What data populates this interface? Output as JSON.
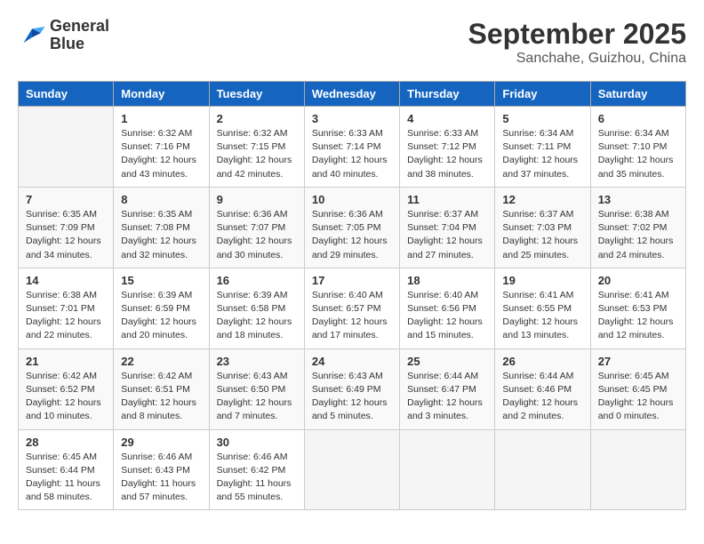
{
  "logo": {
    "line1": "General",
    "line2": "Blue"
  },
  "title": "September 2025",
  "location": "Sanchahe, Guizhou, China",
  "days_of_week": [
    "Sunday",
    "Monday",
    "Tuesday",
    "Wednesday",
    "Thursday",
    "Friday",
    "Saturday"
  ],
  "weeks": [
    [
      {
        "day": "",
        "info": ""
      },
      {
        "day": "1",
        "info": "Sunrise: 6:32 AM\nSunset: 7:16 PM\nDaylight: 12 hours\nand 43 minutes."
      },
      {
        "day": "2",
        "info": "Sunrise: 6:32 AM\nSunset: 7:15 PM\nDaylight: 12 hours\nand 42 minutes."
      },
      {
        "day": "3",
        "info": "Sunrise: 6:33 AM\nSunset: 7:14 PM\nDaylight: 12 hours\nand 40 minutes."
      },
      {
        "day": "4",
        "info": "Sunrise: 6:33 AM\nSunset: 7:12 PM\nDaylight: 12 hours\nand 38 minutes."
      },
      {
        "day": "5",
        "info": "Sunrise: 6:34 AM\nSunset: 7:11 PM\nDaylight: 12 hours\nand 37 minutes."
      },
      {
        "day": "6",
        "info": "Sunrise: 6:34 AM\nSunset: 7:10 PM\nDaylight: 12 hours\nand 35 minutes."
      }
    ],
    [
      {
        "day": "7",
        "info": "Sunrise: 6:35 AM\nSunset: 7:09 PM\nDaylight: 12 hours\nand 34 minutes."
      },
      {
        "day": "8",
        "info": "Sunrise: 6:35 AM\nSunset: 7:08 PM\nDaylight: 12 hours\nand 32 minutes."
      },
      {
        "day": "9",
        "info": "Sunrise: 6:36 AM\nSunset: 7:07 PM\nDaylight: 12 hours\nand 30 minutes."
      },
      {
        "day": "10",
        "info": "Sunrise: 6:36 AM\nSunset: 7:05 PM\nDaylight: 12 hours\nand 29 minutes."
      },
      {
        "day": "11",
        "info": "Sunrise: 6:37 AM\nSunset: 7:04 PM\nDaylight: 12 hours\nand 27 minutes."
      },
      {
        "day": "12",
        "info": "Sunrise: 6:37 AM\nSunset: 7:03 PM\nDaylight: 12 hours\nand 25 minutes."
      },
      {
        "day": "13",
        "info": "Sunrise: 6:38 AM\nSunset: 7:02 PM\nDaylight: 12 hours\nand 24 minutes."
      }
    ],
    [
      {
        "day": "14",
        "info": "Sunrise: 6:38 AM\nSunset: 7:01 PM\nDaylight: 12 hours\nand 22 minutes."
      },
      {
        "day": "15",
        "info": "Sunrise: 6:39 AM\nSunset: 6:59 PM\nDaylight: 12 hours\nand 20 minutes."
      },
      {
        "day": "16",
        "info": "Sunrise: 6:39 AM\nSunset: 6:58 PM\nDaylight: 12 hours\nand 18 minutes."
      },
      {
        "day": "17",
        "info": "Sunrise: 6:40 AM\nSunset: 6:57 PM\nDaylight: 12 hours\nand 17 minutes."
      },
      {
        "day": "18",
        "info": "Sunrise: 6:40 AM\nSunset: 6:56 PM\nDaylight: 12 hours\nand 15 minutes."
      },
      {
        "day": "19",
        "info": "Sunrise: 6:41 AM\nSunset: 6:55 PM\nDaylight: 12 hours\nand 13 minutes."
      },
      {
        "day": "20",
        "info": "Sunrise: 6:41 AM\nSunset: 6:53 PM\nDaylight: 12 hours\nand 12 minutes."
      }
    ],
    [
      {
        "day": "21",
        "info": "Sunrise: 6:42 AM\nSunset: 6:52 PM\nDaylight: 12 hours\nand 10 minutes."
      },
      {
        "day": "22",
        "info": "Sunrise: 6:42 AM\nSunset: 6:51 PM\nDaylight: 12 hours\nand 8 minutes."
      },
      {
        "day": "23",
        "info": "Sunrise: 6:43 AM\nSunset: 6:50 PM\nDaylight: 12 hours\nand 7 minutes."
      },
      {
        "day": "24",
        "info": "Sunrise: 6:43 AM\nSunset: 6:49 PM\nDaylight: 12 hours\nand 5 minutes."
      },
      {
        "day": "25",
        "info": "Sunrise: 6:44 AM\nSunset: 6:47 PM\nDaylight: 12 hours\nand 3 minutes."
      },
      {
        "day": "26",
        "info": "Sunrise: 6:44 AM\nSunset: 6:46 PM\nDaylight: 12 hours\nand 2 minutes."
      },
      {
        "day": "27",
        "info": "Sunrise: 6:45 AM\nSunset: 6:45 PM\nDaylight: 12 hours\nand 0 minutes."
      }
    ],
    [
      {
        "day": "28",
        "info": "Sunrise: 6:45 AM\nSunset: 6:44 PM\nDaylight: 11 hours\nand 58 minutes."
      },
      {
        "day": "29",
        "info": "Sunrise: 6:46 AM\nSunset: 6:43 PM\nDaylight: 11 hours\nand 57 minutes."
      },
      {
        "day": "30",
        "info": "Sunrise: 6:46 AM\nSunset: 6:42 PM\nDaylight: 11 hours\nand 55 minutes."
      },
      {
        "day": "",
        "info": ""
      },
      {
        "day": "",
        "info": ""
      },
      {
        "day": "",
        "info": ""
      },
      {
        "day": "",
        "info": ""
      }
    ]
  ]
}
